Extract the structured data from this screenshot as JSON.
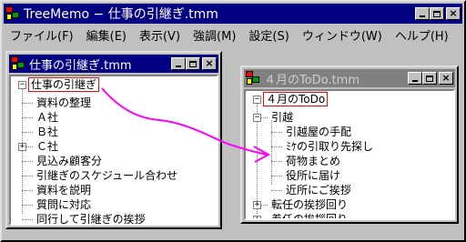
{
  "main_window": {
    "title": "TreeMemo − 仕事の引継ぎ.tmm",
    "menu": [
      "ファイル(F)",
      "編集(E)",
      "表示(V)",
      "強調(M)",
      "設定(S)",
      "ウィンドウ(W)",
      "ヘルプ(H)"
    ]
  },
  "doc1": {
    "title": "仕事の引継ぎ.tmm",
    "root": "仕事の引継ぎ",
    "items": [
      "資料の整理",
      "Ａ社",
      "Ｂ社",
      "Ｃ社",
      "見込み顧客分",
      "引継ぎのスケジュール合わせ",
      "資料を説明",
      "質問に対応",
      "同行して引継ぎの挨拶"
    ]
  },
  "doc2": {
    "title": "４月のToDo.tmm",
    "root": "４月のToDo",
    "group": "引越",
    "group_items": [
      "引越屋の手配",
      "ﾐｹの引取り先探し",
      "荷物まとめ",
      "役所に届け",
      "近所にご挨拶"
    ],
    "collapsed_items": [
      "転任の挨拶回り",
      "着任の挨拶回り"
    ]
  },
  "buttons": {
    "minimize": "_",
    "maximize": "□",
    "close": "×"
  },
  "colors": {
    "active_title": "#000080",
    "inactive_title": "#808080",
    "selection_border": "#ff0000",
    "drag_arrow": "#ff00ff"
  }
}
